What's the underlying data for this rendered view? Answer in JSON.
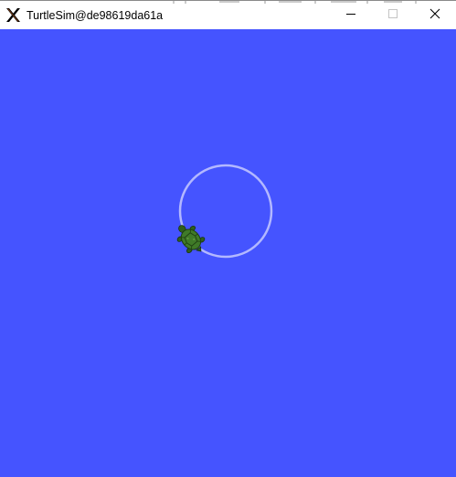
{
  "window": {
    "title": "TurtleSim@de98619da61a",
    "app_icon": "x11-logo-icon",
    "controls": {
      "minimize_icon": "minimize-icon",
      "maximize_icon": "maximize-icon",
      "close_icon": "close-icon"
    }
  },
  "canvas": {
    "background_color": "#4554ff",
    "trail_color": "#b3b8ff",
    "turtle_icon": "turtle-icon",
    "turtle_shell_color": "#3f7a28",
    "turtle_skin_color": "#2f5e1d"
  }
}
